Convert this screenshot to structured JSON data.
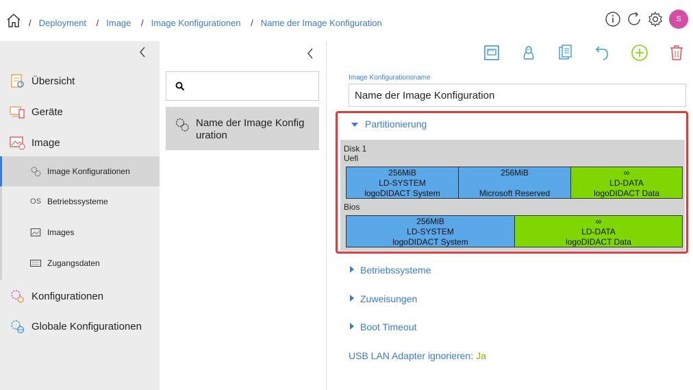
{
  "breadcrumb": {
    "items": [
      "Deployment",
      "Image",
      "Image Konfigurationen",
      "Name der Image Konfiguration"
    ]
  },
  "topbar": {
    "avatar_initial": "S",
    "icons": [
      "info-icon",
      "refresh-icon",
      "gear-icon"
    ]
  },
  "sidebar": {
    "items": [
      {
        "label": "Übersicht",
        "icon": "overview-icon"
      },
      {
        "label": "Geräte",
        "icon": "devices-icon"
      },
      {
        "label": "Image",
        "icon": "image-icon"
      }
    ],
    "subitems": [
      {
        "label": "Image Konfigurationen",
        "icon": "gear-cluster-icon",
        "selected": true
      },
      {
        "label": "Betriebssysteme",
        "icon_text": "OS"
      },
      {
        "label": "Images",
        "icon": "picture-icon"
      },
      {
        "label": "Zugangsdaten",
        "icon": "keyboard-icon"
      }
    ],
    "items_bottom": [
      {
        "label": "Konfigurationen",
        "icon": "config-icon"
      },
      {
        "label": "Globale Konfigurationen",
        "icon": "global-config-icon"
      }
    ]
  },
  "list": {
    "search_placeholder": "",
    "items": [
      {
        "label": "Name der Image Konfig uration"
      }
    ]
  },
  "toolbar": {
    "icons": [
      "network-icon",
      "linux-icon",
      "copy-icon",
      "undo-icon",
      "add-icon",
      "delete-icon"
    ]
  },
  "detail": {
    "name_label": "Image Konfigurationsname",
    "name_value": "Name der Image Konfiguration",
    "partitioning_title": "Partitionierung",
    "disk_label": "Disk 1",
    "uefi_label": "Uefi",
    "bios_label": "Bios",
    "uefi_partitions": [
      {
        "size": "256MiB",
        "name": "LD-SYSTEM",
        "label": "logoDIDACT System",
        "color": "#5aa8e8"
      },
      {
        "size": "256MiB",
        "name": "",
        "label": "Microsoft Reserved",
        "color": "#5aa8e8"
      },
      {
        "size": "∞",
        "name": "LD-DATA",
        "label": "logoDIDACT Data",
        "color": "#7fd600"
      }
    ],
    "bios_partitions": [
      {
        "size": "256MiB",
        "name": "LD-SYSTEM",
        "label": "logoDIDACT System",
        "color": "#5aa8e8"
      },
      {
        "size": "∞",
        "name": "LD-DATA",
        "label": "logoDIDACT Data",
        "color": "#7fd600"
      }
    ],
    "sections": [
      "Betriebssysteme",
      "Zuweisungen",
      "Boot Timeout"
    ],
    "usb_label": "USB LAN Adapter ignorieren:",
    "usb_value": "Ja"
  },
  "colors": {
    "accent": "#3a7bd5",
    "highlight": "#e23b3b",
    "ok": "#7fba00"
  }
}
